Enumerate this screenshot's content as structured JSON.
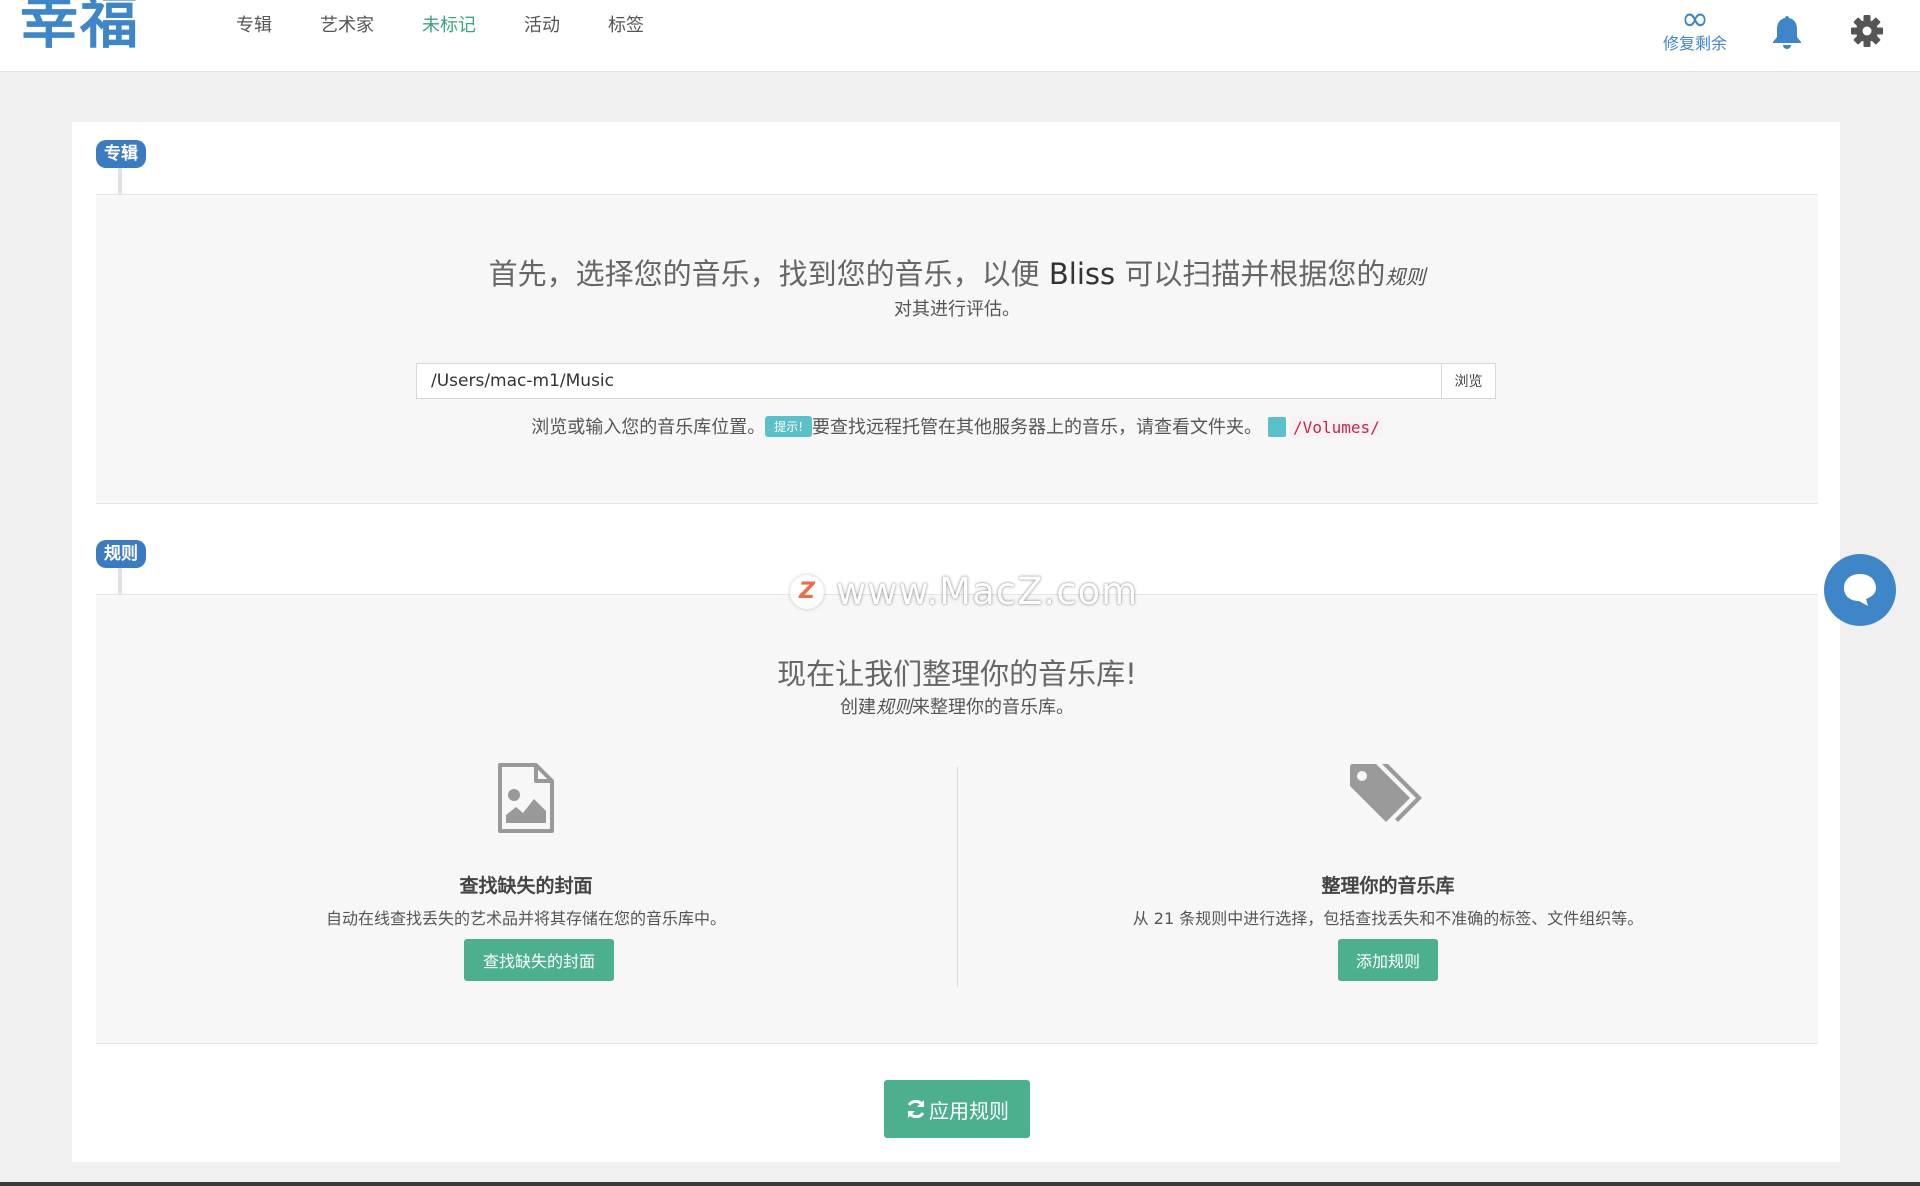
{
  "app": {
    "logo_text": "幸福",
    "accent_color": "#3f86c8",
    "brand_green": "#4cb08f"
  },
  "nav": {
    "tabs": [
      {
        "label": "专辑",
        "active": false
      },
      {
        "label": "艺术家",
        "active": false
      },
      {
        "label": "未标记",
        "active": true
      },
      {
        "label": "活动",
        "active": false
      },
      {
        "label": "标签",
        "active": false
      }
    ],
    "repair_symbol": "∞",
    "repair_label": "修复剩余",
    "icons": [
      "bell-icon",
      "gear-icon"
    ]
  },
  "albums_section": {
    "badge": "专辑",
    "headline_pre": "首先，选择您的音乐，找到您的音乐，以便 ",
    "headline_brand": "Bliss",
    "headline_post": " 可以扫描并根据您的",
    "headline_emph": "规则",
    "subline": "对其进行评估。",
    "path_value": "/Users/mac-m1/Music",
    "browse_label": "浏览",
    "hint_pre": "浏览或输入您的音乐库位置。",
    "tip_label": "提示!",
    "hint_post": "要查找远程托管在其他服务器上的音乐，请查看文件夹。",
    "folder_code": "/Volumes/"
  },
  "rules_section": {
    "badge": "规则",
    "headline": "现在让我们整理你的音乐库!",
    "sub_pre": "创建",
    "sub_emph": "规则",
    "sub_post": "来整理你的音乐库。",
    "left": {
      "icon": "image-file-icon",
      "title": "查找缺失的封面",
      "desc": "自动在线查找丢失的艺术品并将其存储在您的音乐库中。",
      "button": "查找缺失的封面"
    },
    "right": {
      "icon": "tags-icon",
      "title": "整理你的音乐库",
      "desc": "从 21 条规则中进行选择，包括查找丢失和不准确的标签、文件组织等。",
      "button": "添加规则"
    }
  },
  "apply_button": "应用规则",
  "watermark": {
    "letter": "Z",
    "text": "www.MacZ.com"
  }
}
